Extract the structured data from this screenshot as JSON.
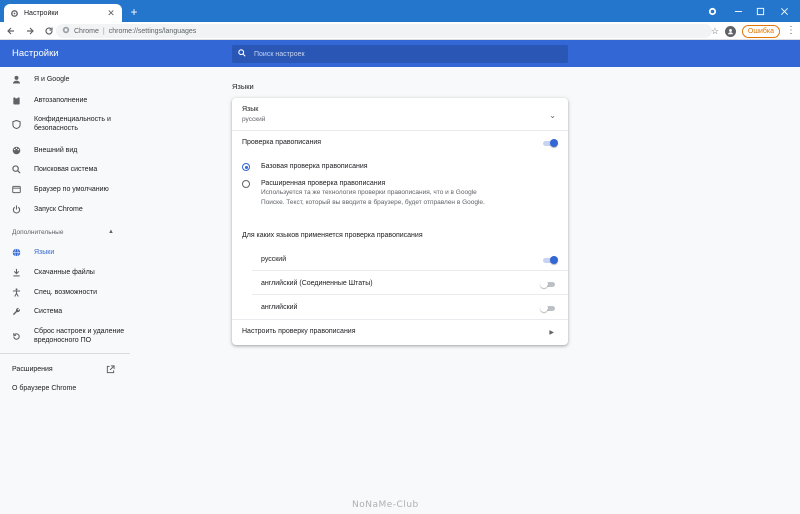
{
  "browser": {
    "tab_title": "Настройки",
    "omnibox_site": "Chrome",
    "omnibox_url": "chrome://settings/languages",
    "error_button": "Ошибка"
  },
  "header": {
    "title": "Настройки",
    "search_placeholder": "Поиск настроек"
  },
  "sidebar": {
    "items": [
      {
        "label": "Я и Google",
        "icon": "person-icon"
      },
      {
        "label": "Автозаполнение",
        "icon": "clipboard-icon"
      },
      {
        "label": "Конфиденциальность и безопасность",
        "icon": "shield-icon"
      },
      {
        "label": "Внешний вид",
        "icon": "palette-icon"
      },
      {
        "label": "Поисковая система",
        "icon": "search-icon"
      },
      {
        "label": "Браузер по умолчанию",
        "icon": "browser-icon"
      },
      {
        "label": "Запуск Chrome",
        "icon": "power-icon"
      }
    ],
    "advanced_label": "Дополнительные",
    "advanced_items": [
      {
        "label": "Языки",
        "icon": "globe-icon",
        "active": true
      },
      {
        "label": "Скачанные файлы",
        "icon": "download-icon"
      },
      {
        "label": "Спец. возможности",
        "icon": "accessibility-icon"
      },
      {
        "label": "Система",
        "icon": "wrench-icon"
      },
      {
        "label": "Сброс настроек и удаление вредоносного ПО",
        "icon": "reset-icon"
      }
    ],
    "extensions_label": "Расширения",
    "about_label": "О браузере Chrome"
  },
  "main": {
    "heading": "Языки",
    "language": {
      "label": "Язык",
      "value": "русский"
    },
    "spellcheck": {
      "label": "Проверка правописания",
      "enabled": true,
      "basic_label": "Базовая проверка правописания",
      "enhanced_label": "Расширенная проверка правописания",
      "enhanced_description": "Используется та же технология проверки правописания, что и в Google Поиске. Текст, который вы вводите в браузере, будет отправлен в Google.",
      "selected": "basic",
      "languages_heading": "Для каких языков применяется проверка правописания",
      "languages": [
        {
          "name": "русский",
          "enabled": true
        },
        {
          "name": "английский (Соединенные Штаты)",
          "enabled": false
        },
        {
          "name": "английский",
          "enabled": false
        }
      ],
      "customize_label": "Настроить проверку правописания"
    }
  },
  "colors": {
    "accent": "#3367d6",
    "title_bar": "#2476cc",
    "error": "#e37400"
  },
  "watermark": "NoNaMe-Club"
}
